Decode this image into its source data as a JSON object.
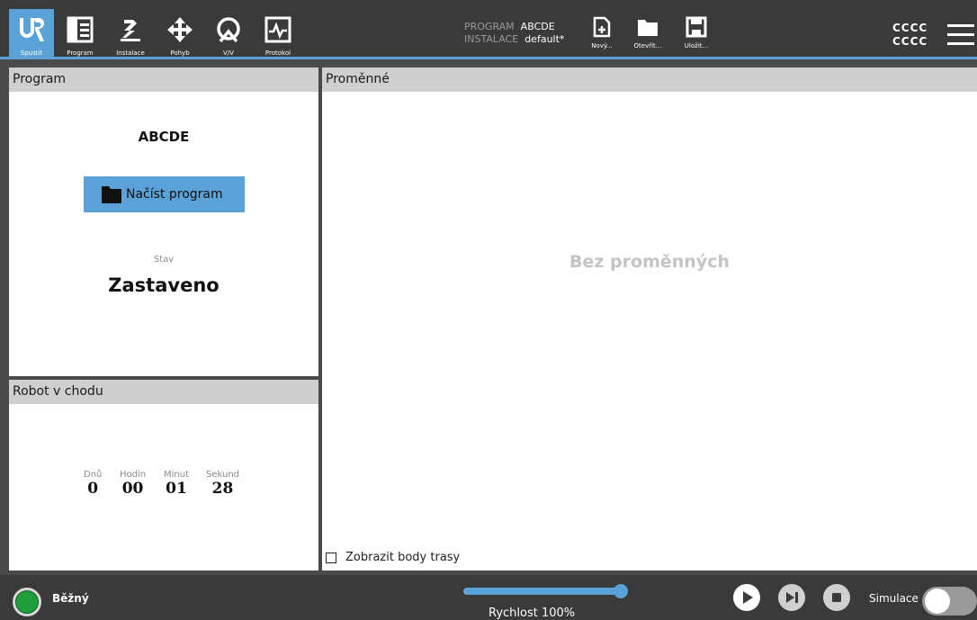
{
  "nav_tabs": [
    {
      "label": "Spustit",
      "icon": "ur-logo-icon"
    },
    {
      "label": "Program",
      "icon": "program-icon"
    },
    {
      "label": "Instalace",
      "icon": "robot-arm-icon"
    },
    {
      "label": "Pohyb",
      "icon": "move-arrows-icon"
    },
    {
      "label": "V/V",
      "icon": "io-icon"
    },
    {
      "label": "Protokol",
      "icon": "log-icon"
    }
  ],
  "program_info": {
    "program_key": "PROGRAM",
    "program_value": "ABCDE",
    "installation_key": "INSTALACE",
    "installation_value": "default*"
  },
  "file_buttons": {
    "new": "Nový...",
    "open": "Otevřít...",
    "save": "Uložit..."
  },
  "user": {
    "line1": "CCCC",
    "line2": "CCCC"
  },
  "program_panel": {
    "header": "Program",
    "program_name": "ABCDE",
    "load_button": "Načíst program",
    "state_label": "Stav",
    "state_value": "Zastaveno"
  },
  "robot_panel": {
    "header": "Robot v chodu",
    "units": {
      "days": "Dnů",
      "hours": "Hodin",
      "minutes": "Minut",
      "seconds": "Sekund"
    },
    "values": {
      "days": "0",
      "hours": "00",
      "minutes": "01",
      "seconds": "28"
    }
  },
  "vars_panel": {
    "header": "Proměnné",
    "empty_text": "Bez proměnných",
    "show_points_label": "Zobrazit body trasy"
  },
  "bottom_bar": {
    "status": "Běžný",
    "status_color": "#1e9f3a",
    "speed_label": "Rychlost 100%",
    "speed_fraction": 1.0,
    "simulation_label": "Simulace"
  },
  "colors": {
    "accent": "#5aa2d8",
    "bar": "#3a3a3a",
    "panel_header": "#cfcfcf"
  }
}
